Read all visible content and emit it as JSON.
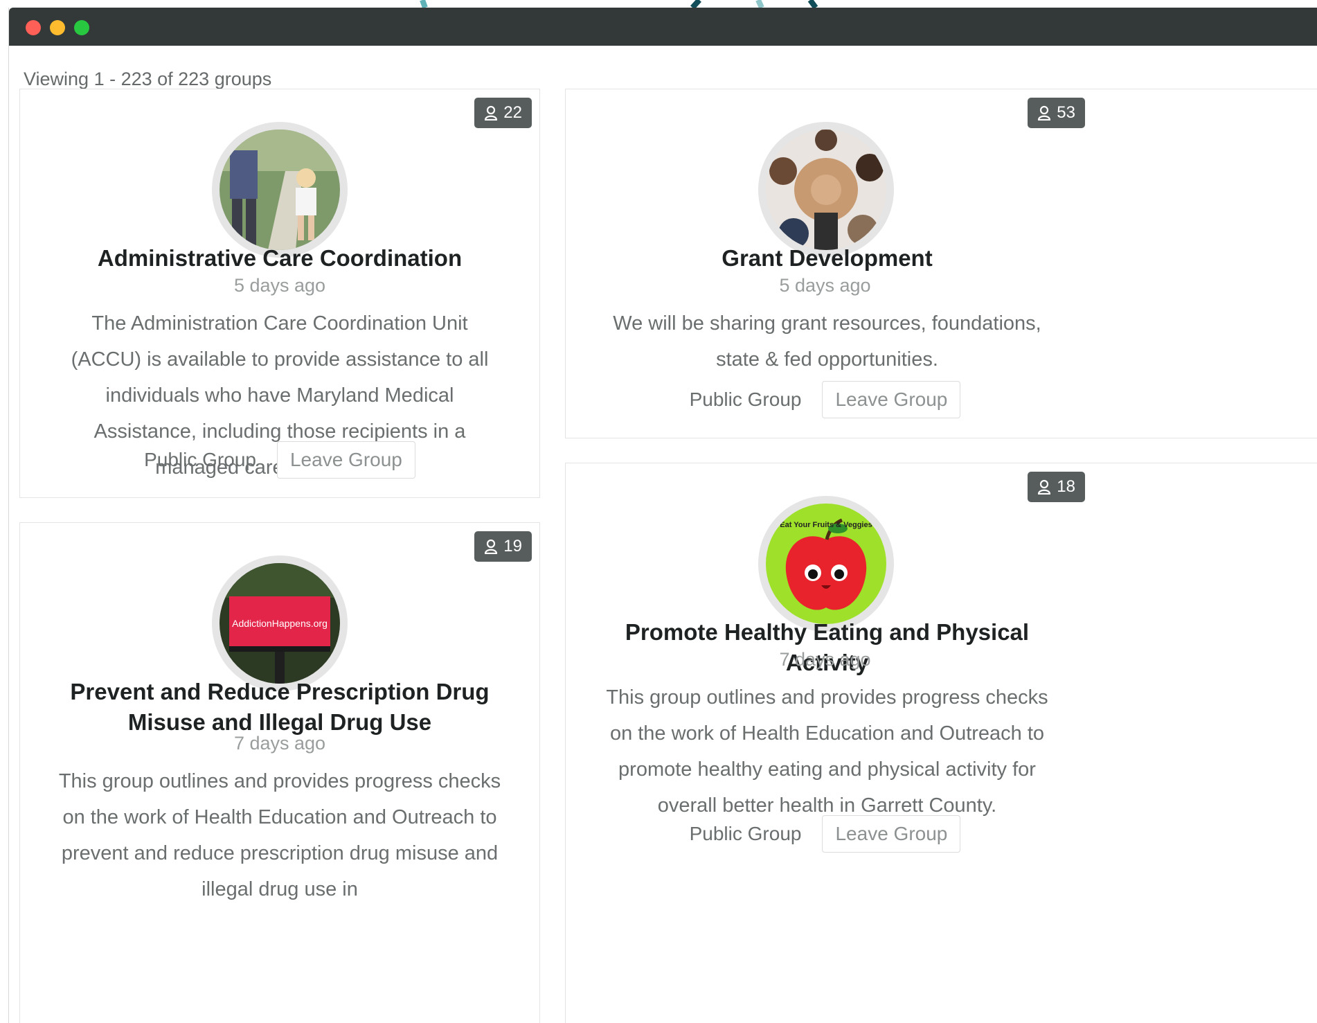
{
  "window": {
    "controls": [
      "close",
      "minimize",
      "maximize"
    ]
  },
  "viewing_text": "Viewing 1 - 223 of 223 groups",
  "groups": [
    {
      "name": "Administrative Care Coordination",
      "members": "22",
      "time": "5 days ago",
      "description": "The Administration Care Coordination Unit (ACCU) is available to provide assistance to all individuals who have Maryland Medical Assistance, including those recipients in a managed care organization.",
      "type": "Public Group",
      "action": "Leave Group",
      "avatar": "parent-and-child-walking-photo"
    },
    {
      "name": "Grant Development",
      "members": "53",
      "time": "5 days ago",
      "description": "We will be sharing grant resources, foundations, state & fed opportunities.",
      "type": "Public Group",
      "action": "Leave Group",
      "avatar": "hands-together-team-photo"
    },
    {
      "name": "Prevent and Reduce Prescription Drug Misuse and Illegal Drug Use",
      "members": "19",
      "time": "7 days ago",
      "description": "This group outlines and provides progress checks on the work of Health Education and Outreach to prevent and reduce prescription drug misuse and illegal drug use in",
      "type": "Public Group",
      "action": "Leave Group",
      "avatar": "billboard-photo",
      "avatar_text": "AddictionHappens.org"
    },
    {
      "name": "Promote Healthy Eating and Physical Activity",
      "members": "18",
      "time": "7 days ago",
      "description": "This group outlines and provides progress checks on the work of Health Education and Outreach to promote healthy eating and physical activity for overall better health in Garrett County.",
      "type": "Public Group",
      "action": "Leave Group",
      "avatar": "apple-cartoon-logo",
      "avatar_text": "Eat Your Fruits & Veggies"
    }
  ],
  "colors": {
    "titlebar": "#333838",
    "badge": "#575c5c",
    "title_text": "#1f2222",
    "body_text": "#6a6e6e",
    "muted_text": "#9a9d9d"
  }
}
